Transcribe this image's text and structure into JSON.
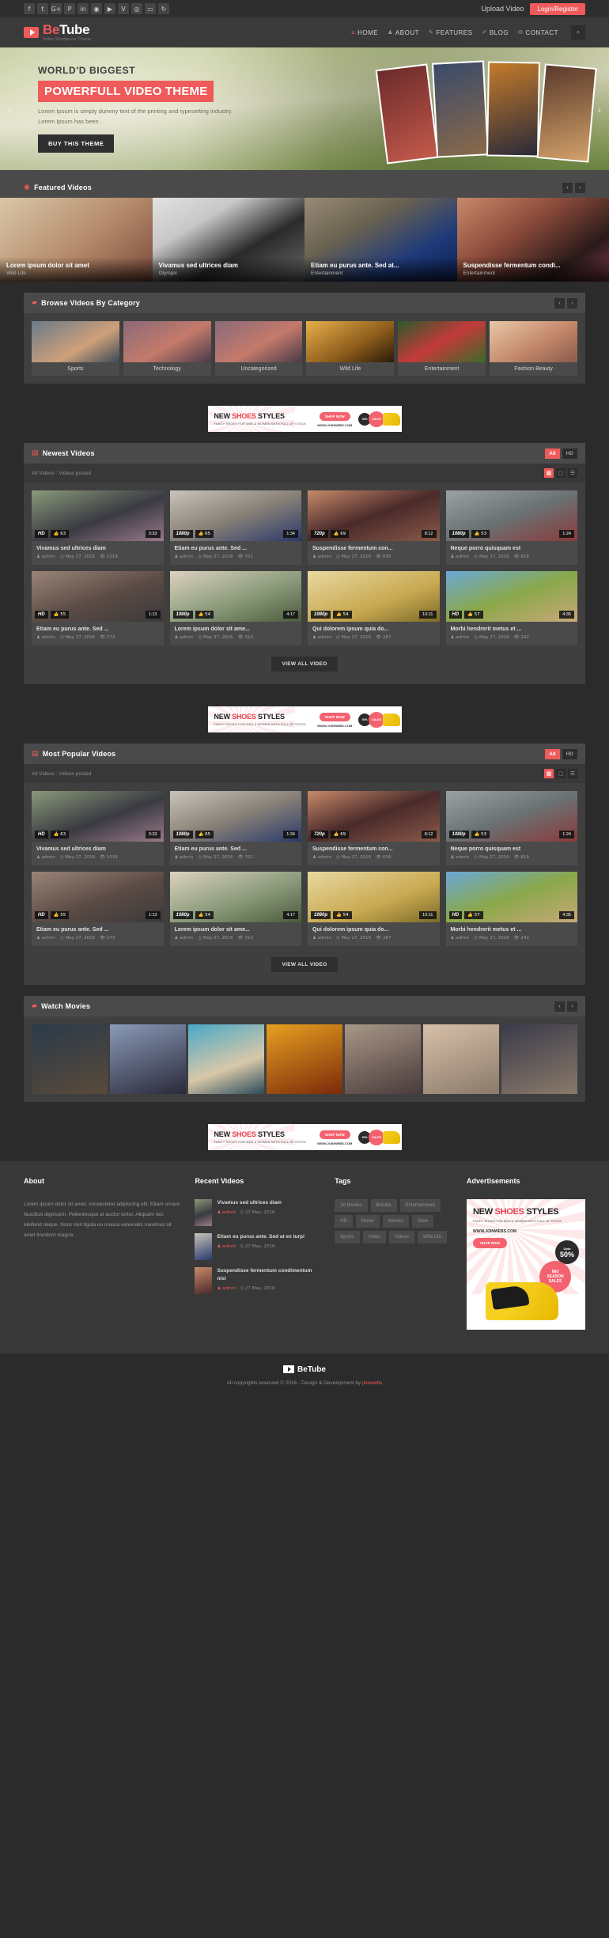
{
  "topbar": {
    "social_icons": [
      "f",
      "t",
      "G+",
      "P",
      "in",
      "◉",
      "▶",
      "V",
      "◎",
      "▭",
      "↻"
    ],
    "upload_label": "Upload Video",
    "login_label": "Login/Register"
  },
  "header": {
    "logo_be": "Be",
    "logo_tube": "Tube",
    "logo_tagline": "Video Wordpress Theme",
    "nav": [
      {
        "label": "HOME",
        "icon": "home-icon",
        "glyph": "⌂",
        "active": true
      },
      {
        "label": "ABOUT",
        "icon": "user-icon",
        "glyph": "♟",
        "active": false
      },
      {
        "label": "FEATURES",
        "icon": "pencil-icon",
        "glyph": "✎",
        "active": false
      },
      {
        "label": "BLOG",
        "icon": "edit-icon",
        "glyph": "✐",
        "active": false
      },
      {
        "label": "CONTACT",
        "icon": "envelope-icon",
        "glyph": "✉",
        "active": false
      }
    ],
    "search_glyph": "⌕"
  },
  "hero": {
    "kicker": "WORLD'D BIGGEST",
    "title": "POWERFULL VIDEO THEME",
    "desc": "Lorem Ipsum is simply dummy text of the printing and typesetting industry. Lorem Ipsum has been .",
    "cta": "BUY THIS THEME",
    "arrow_left": "‹",
    "arrow_right": "›"
  },
  "featured": {
    "heading": "Featured Videos",
    "heading_glyph": "◉",
    "prev": "‹",
    "next": "›",
    "items": [
      {
        "title": "Lorem ipsum dolor sit amet",
        "category": "Wild Life"
      },
      {
        "title": "Vivamus sed ultrices diam",
        "category": "Olympic"
      },
      {
        "title": "Etiam eu purus ante. Sed at...",
        "category": "Entertainment"
      },
      {
        "title": "Suspendisse fermentum condi...",
        "category": "Entertainment"
      }
    ]
  },
  "categories": {
    "heading": "Browse Videos By Category",
    "heading_glyph": "▰",
    "prev": "‹",
    "next": "›",
    "items": [
      {
        "name": "Sports"
      },
      {
        "name": "Technology"
      },
      {
        "name": "Uncategorized"
      },
      {
        "name": "Wild Life"
      },
      {
        "name": "Entertainment"
      },
      {
        "name": "Fashion Beauty"
      }
    ]
  },
  "ad": {
    "title_new": "NEW ",
    "title_shoes": "SHOES",
    "title_styles": " STYLES",
    "subtitle": "FANCY SHOES FOR MEN & WOMEN WITH FULL OF STOCK",
    "shop_now": "SHOP NOW",
    "url": "WWW.JOINWEBS.COM",
    "badge_upto": "Upto",
    "badge_pct": "50%",
    "badge_mid": "Mid",
    "badge_season": "SEASON",
    "badge_sales": "SALES"
  },
  "newest": {
    "heading": "Newest Videos",
    "heading_glyph": "▤",
    "filters": [
      {
        "label": "All",
        "on": true
      },
      {
        "label": "HD",
        "on": false
      }
    ],
    "filterbar_label": "All Videos :  Videos posted",
    "view_modes": [
      {
        "glyph": "▦",
        "on": true
      },
      {
        "glyph": "▢",
        "on": false
      },
      {
        "glyph": "☰",
        "on": false
      }
    ],
    "view_all": "VIEW ALL VIDEO",
    "videos": [
      {
        "title": "Vivamus sed ultrices diam",
        "quality": "HD",
        "likes": "63",
        "duration": "3:33",
        "author": "admin",
        "date": "May 27, 2016",
        "views": "1018"
      },
      {
        "title": "Etiam eu purus ante. Sed ...",
        "quality": "1080p",
        "likes": "65",
        "duration": "1:34",
        "author": "admin",
        "date": "May 27, 2016",
        "views": "701"
      },
      {
        "title": "Suspendisse fermentum con...",
        "quality": "720p",
        "likes": "69",
        "duration": "8:12",
        "author": "admin",
        "date": "May 27, 2016",
        "views": "658"
      },
      {
        "title": "Neque porro quisquam est",
        "quality": "1080p",
        "likes": "53",
        "duration": "1:24",
        "author": "admin",
        "date": "May 27, 2016",
        "views": "818"
      },
      {
        "title": "Etiam eu purus ante. Sed ...",
        "quality": "HD",
        "likes": "55",
        "duration": "1:13",
        "author": "admin",
        "date": "May 27, 2016",
        "views": "273"
      },
      {
        "title": "Lorem ipsum dolor sit ame...",
        "quality": "1080p",
        "likes": "54",
        "duration": "4:17",
        "author": "admin",
        "date": "May 27, 2016",
        "views": "310"
      },
      {
        "title": "Qui dolorem ipsum quia do...",
        "quality": "1080p",
        "likes": "54",
        "duration": "10:11",
        "author": "admin",
        "date": "May 27, 2016",
        "views": "287"
      },
      {
        "title": "Morbi hendrerit metus et ...",
        "quality": "HD",
        "likes": "57",
        "duration": "4:35",
        "author": "admin",
        "date": "May 27, 2016",
        "views": "242"
      }
    ]
  },
  "popular": {
    "heading": "Most Popular Videos",
    "heading_glyph": "▤",
    "filters": [
      {
        "label": "All",
        "on": true
      },
      {
        "label": "HD",
        "on": false
      }
    ],
    "filterbar_label": "All Videos :  Videos posted",
    "view_modes": [
      {
        "glyph": "▦",
        "on": true
      },
      {
        "glyph": "▢",
        "on": false
      },
      {
        "glyph": "☰",
        "on": false
      }
    ],
    "view_all": "VIEW ALL VIDEO",
    "videos": [
      {
        "title": "Vivamus sed ultrices diam",
        "quality": "HD",
        "likes": "63",
        "duration": "3:33",
        "author": "admin",
        "date": "May 27, 2016",
        "views": "1018"
      },
      {
        "title": "Etiam eu purus ante. Sed ...",
        "quality": "1080p",
        "likes": "65",
        "duration": "1:34",
        "author": "admin",
        "date": "May 27, 2016",
        "views": "701"
      },
      {
        "title": "Suspendisse fermentum con...",
        "quality": "720p",
        "likes": "69",
        "duration": "8:12",
        "author": "admin",
        "date": "May 27, 2016",
        "views": "658"
      },
      {
        "title": "Neque porro quisquam est",
        "quality": "1080p",
        "likes": "53",
        "duration": "1:24",
        "author": "admin",
        "date": "May 27, 2016",
        "views": "818"
      },
      {
        "title": "Etiam eu purus ante. Sed ...",
        "quality": "HD",
        "likes": "55",
        "duration": "1:13",
        "author": "admin",
        "date": "May 27, 2016",
        "views": "273"
      },
      {
        "title": "Lorem ipsum dolor sit ame...",
        "quality": "1080p",
        "likes": "54",
        "duration": "4:17",
        "author": "admin",
        "date": "May 27, 2016",
        "views": "310"
      },
      {
        "title": "Qui dolorem ipsum quia do...",
        "quality": "1080p",
        "likes": "54",
        "duration": "10:11",
        "author": "admin",
        "date": "May 27, 2016",
        "views": "287"
      },
      {
        "title": "Morbi hendrerit metus et ...",
        "quality": "HD",
        "likes": "57",
        "duration": "4:35",
        "author": "admin",
        "date": "May 27, 2016",
        "views": "242"
      }
    ]
  },
  "movies": {
    "heading": "Watch Movies",
    "heading_glyph": "▰",
    "prev": "‹",
    "next": "›",
    "count": 7
  },
  "footer": {
    "about": {
      "heading": "About",
      "text": "Lorem ipsum dolor sit amet, consectetur adipiscing elit. Etiam ornare faucibus dignissim. Pellentesque at auctor tortor. Aliquam nec eleifend neque. Nunc non ligula eu massa venenatis maximus sit amet tincidunt magna."
    },
    "recent": {
      "heading": "Recent Videos",
      "items": [
        {
          "title": "Vivamus sed ultrices diam",
          "author": "admin",
          "date": "27 May, 2016"
        },
        {
          "title": "Etiam eu purus ante. Sed at ex turpi",
          "author": "admin",
          "date": "27 May, 2016"
        },
        {
          "title": "Suspendisse fermentum condimentum nisi",
          "author": "admin",
          "date": "27 May, 2016"
        }
      ]
    },
    "tags": {
      "heading": "Tags",
      "items": [
        "3d Movies",
        "Betube",
        "Entertainment",
        "HD",
        "Movie",
        "Movies",
        "Slow",
        "Sports",
        "Video",
        "Videos",
        "Wild Life"
      ]
    },
    "ads": {
      "heading": "Advertisements"
    }
  },
  "bottom": {
    "logo_text": "BeTube",
    "copyright_pre": "All copyrights reserved © 2016 - Design & Development by ",
    "copyright_link": "joinwebs"
  }
}
